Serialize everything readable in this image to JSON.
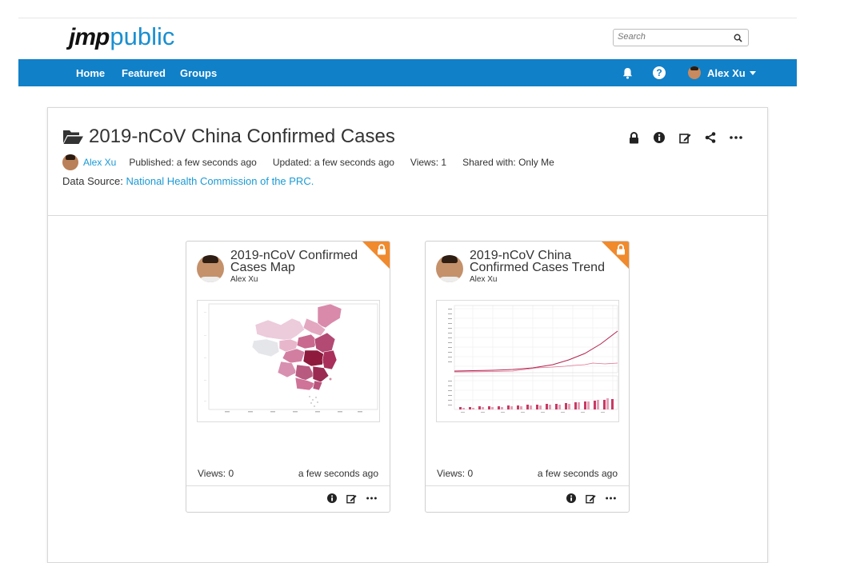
{
  "header": {
    "logo_jmp": "jmp",
    "logo_public": "public",
    "search_placeholder": "Search"
  },
  "nav": {
    "items": [
      "Home",
      "Featured",
      "Groups"
    ],
    "user_name": "Alex Xu"
  },
  "post": {
    "title": "2019-nCoV China Confirmed Cases",
    "author": "Alex Xu",
    "published": "Published: a few seconds ago",
    "updated": "Updated: a few seconds ago",
    "views": "Views: 1",
    "shared": "Shared with: Only Me",
    "source_label": "Data Source: ",
    "source_link": "National Health Commission of the PRC."
  },
  "cards": [
    {
      "title": "2019-nCoV Confirmed Cases Map",
      "author": "Alex Xu",
      "views": "Views: 0",
      "time": "a few seconds ago"
    },
    {
      "title": "2019-nCoV China Confirmed Cases Trend",
      "author": "Alex Xu",
      "views": "Views: 0",
      "time": "a few seconds ago"
    }
  ],
  "colors": {
    "navbar": "#1080c8",
    "link": "#1a9ad6",
    "lock_badge": "#f08a2c",
    "map_dark": "#8e1b3e",
    "map_light": "#eccbdb"
  }
}
